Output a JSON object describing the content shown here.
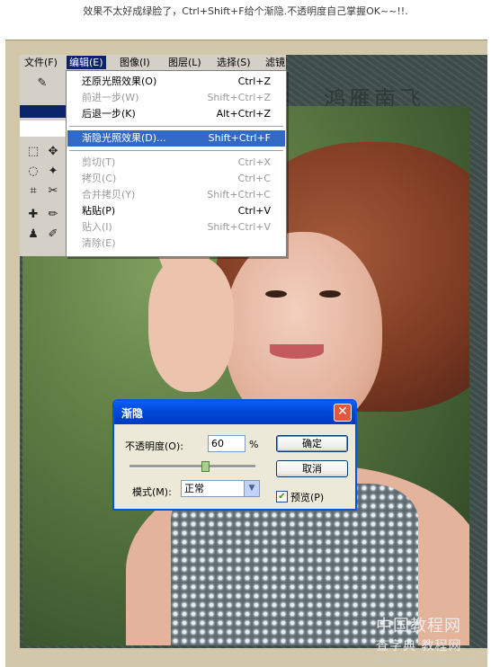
{
  "caption": "效果不太好成绿脸了，Ctrl+Shift+F给个渐隐.不透明度自己掌握OK~~!!.",
  "background": {
    "title": "鸿雁南飞"
  },
  "menubar": {
    "items": [
      {
        "label": "文件(F)"
      },
      {
        "label": "编辑(E)"
      },
      {
        "label": "图像(I)"
      },
      {
        "label": "图层(L)"
      },
      {
        "label": "选择(S)"
      },
      {
        "label": "滤镜"
      }
    ]
  },
  "edit_menu": {
    "items": [
      {
        "label": "还原光照效果(O)",
        "shortcut": "Ctrl+Z"
      },
      {
        "label": "前进一步(W)",
        "shortcut": "Shift+Ctrl+Z"
      },
      {
        "label": "后退一步(K)",
        "shortcut": "Alt+Ctrl+Z"
      },
      {
        "label": "渐隐光照效果(D)...",
        "shortcut": "Shift+Ctrl+F"
      },
      {
        "label": "剪切(T)",
        "shortcut": "Ctrl+X"
      },
      {
        "label": "拷贝(C)",
        "shortcut": "Ctrl+C"
      },
      {
        "label": "合并拷贝(Y)",
        "shortcut": "Shift+Ctrl+C"
      },
      {
        "label": "粘贴(P)",
        "shortcut": "Ctrl+V"
      },
      {
        "label": "贴入(I)",
        "shortcut": "Shift+Ctrl+V"
      },
      {
        "label": "清除(E)",
        "shortcut": ""
      }
    ]
  },
  "fade_dialog": {
    "title": "渐隐",
    "close": "✕",
    "opacity_label": "不透明度(O):",
    "opacity_value": "60",
    "opacity_unit": "%",
    "opacity_level": 60,
    "ok_label": "确定",
    "cancel_label": "取消",
    "mode_label": "模式(M):",
    "mode_value": "正常",
    "preview_label": "预览(P)",
    "preview_checked": true
  },
  "watermark": {
    "line1": "中国教程网",
    "line2": "查字典 教程网",
    "line3": "jiaocheng.chazidian.com"
  }
}
